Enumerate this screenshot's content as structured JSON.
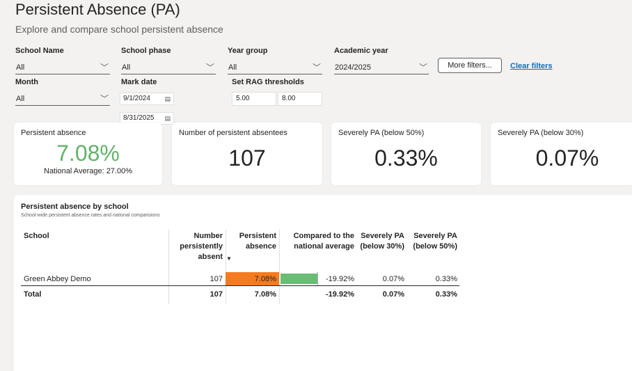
{
  "header": {
    "title": "Persistent Absence (PA)",
    "subtitle": "Explore and compare school persistent absence"
  },
  "filters": {
    "school_name": {
      "label": "School Name",
      "value": "All"
    },
    "school_phase": {
      "label": "School phase",
      "value": "All"
    },
    "year_group": {
      "label": "Year group",
      "value": "All"
    },
    "academic_year": {
      "label": "Academic year",
      "value": "2024/2025"
    },
    "month": {
      "label": "Month",
      "value": "All"
    },
    "mark_date": {
      "label": "Mark date",
      "start": "9/1/2024",
      "end": "8/31/2025"
    },
    "rag": {
      "label": "Set RAG thresholds",
      "low": "5.00",
      "high": "8.00"
    },
    "more_filters_label": "More filters...",
    "clear_filters_label": "Clear filters"
  },
  "kpis": {
    "persistent_absence": {
      "title": "Persistent absence",
      "value": "7.08%",
      "note": "National Average: 27.00%"
    },
    "absentees": {
      "title": "Number of persistent absentees",
      "value": "107"
    },
    "severe50": {
      "title": "Severely PA (below 50%)",
      "value": "0.33%"
    },
    "severe30": {
      "title": "Severely PA (below 30%)",
      "value": "0.07%"
    }
  },
  "table": {
    "title": "Persistent absence by school",
    "subtitle": "School-wide persistent absence rates and national comparisions",
    "columns": {
      "school": "School",
      "number": [
        "Number",
        "persistently",
        "absent"
      ],
      "pa": [
        "Persistent",
        "absence"
      ],
      "compared": [
        "Compared to the",
        "national average"
      ],
      "sev30": [
        "Severely PA",
        "(below 30%)"
      ],
      "sev50": [
        "Severely PA",
        "(below 50%)"
      ]
    },
    "sort_indicator": "▼",
    "row": {
      "school": "Green Abbey Demo",
      "number": "107",
      "pa": "7.08%",
      "compared": "-19.92%",
      "compared_bar_fraction": 0.5,
      "sev30": "0.07%",
      "sev50": "0.33%"
    },
    "total": {
      "school": "Total",
      "number": "107",
      "pa": "7.08%",
      "compared": "-19.92%",
      "sev30": "0.07%",
      "sev50": "0.33%"
    }
  },
  "icons": {
    "chevron": "chevron-down-icon",
    "calendar": "calendar-icon"
  },
  "colors": {
    "kpi_green": "#62b36a",
    "rag_orange": "#f47b20",
    "bar_green": "#69bd75",
    "link_blue": "#0f6cbd"
  }
}
